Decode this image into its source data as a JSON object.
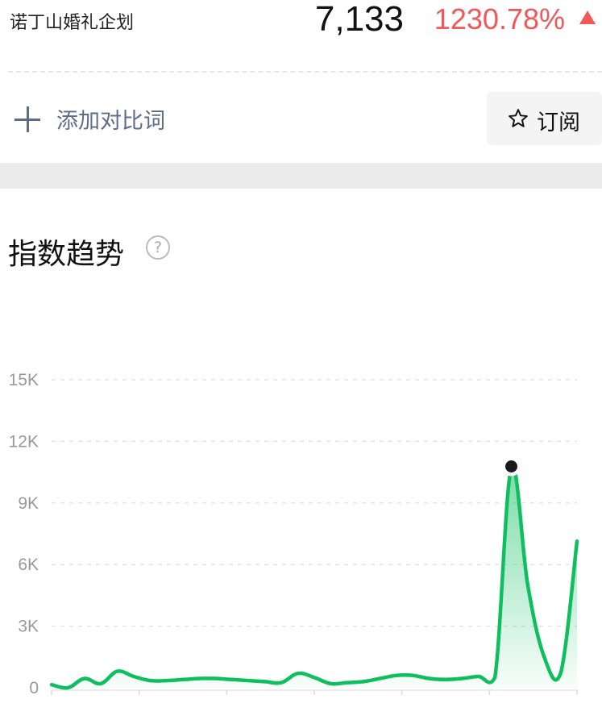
{
  "header": {
    "keyword": "诺丁山婚礼企划",
    "index_value": "7,133",
    "change_percent": "1230.78%",
    "change_color": "#f0585a",
    "change_direction_icon": "triangle-up-icon"
  },
  "compare": {
    "add_label": "添加对比词",
    "add_icon": "plus-icon"
  },
  "subscribe": {
    "label": "订阅",
    "icon": "star-outline-icon"
  },
  "section": {
    "title": "指数趋势",
    "help_icon": "question-circle-icon",
    "help_glyph": "?"
  },
  "chart_data": {
    "type": "area",
    "line_color": "#0fbf5f",
    "ylim": [
      0,
      15000
    ],
    "yticks": [
      {
        "value": 0,
        "label": "0"
      },
      {
        "value": 3000,
        "label": "3K"
      },
      {
        "value": 6000,
        "label": "6K"
      },
      {
        "value": 9000,
        "label": "9K"
      },
      {
        "value": 12000,
        "label": "12K"
      },
      {
        "value": 15000,
        "label": "15K"
      }
    ],
    "grid": true,
    "x_tick_count": 7,
    "series": [
      {
        "values": [
          150,
          0,
          450,
          200,
          800,
          550,
          350,
          350,
          400,
          450,
          450,
          400,
          350,
          300,
          250,
          700,
          500,
          200,
          250,
          300,
          450,
          600,
          600,
          450,
          400,
          450,
          550,
          500,
          10700,
          5000,
          1500,
          700,
          7133
        ],
        "highlight_index": 28
      }
    ]
  }
}
